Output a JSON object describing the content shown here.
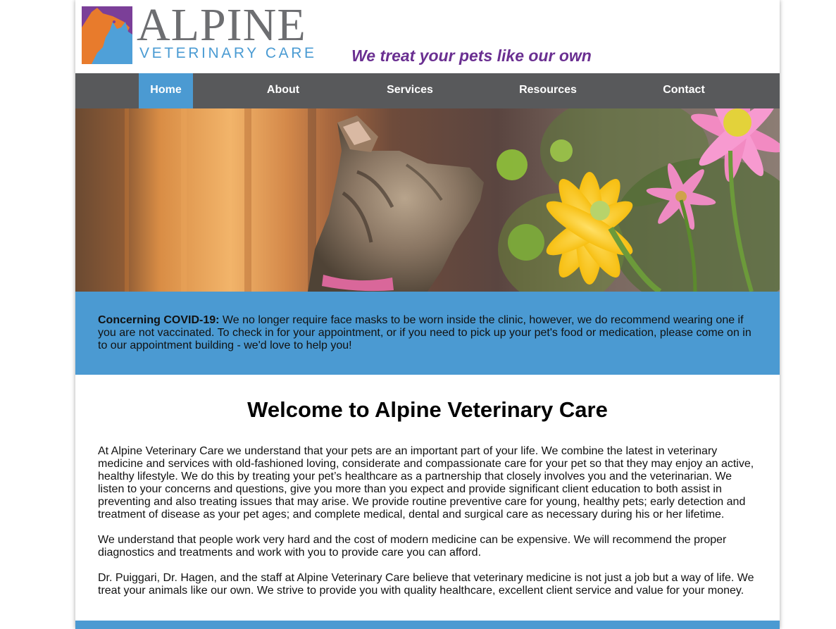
{
  "header": {
    "logo_word": "ALPINE",
    "logo_sub": "VETERINARY CARE",
    "tagline": "We treat your pets like our own"
  },
  "nav": {
    "items": [
      {
        "label": "Home",
        "active": true
      },
      {
        "label": "About",
        "active": false
      },
      {
        "label": "Services",
        "active": false
      },
      {
        "label": "Resources",
        "active": false
      },
      {
        "label": "Contact",
        "active": false
      }
    ]
  },
  "alert": {
    "heading": "Concerning COVID-19:",
    "body": " We no longer require face masks to be worn inside the clinic, however, we do recommend wearing one if you are not vaccinated. To check in for your appointment, or if you need to pick up your pet's food or medication, please come on in to our appointment building - we'd love to help you!"
  },
  "main": {
    "title": "Welcome to Alpine Veterinary Care",
    "paragraphs": [
      "At Alpine Veterinary Care we understand that your pets are an important part of your life. We combine the latest in veterinary medicine and services with old-fashioned loving, considerate and compassionate care for your pet so that they may enjoy an active, healthy lifestyle. We do this by treating your pet’s healthcare as a partnership that closely involves you and the veterinarian. We listen to your concerns and questions, give you more than you expect and provide significant client education to both assist in preventing and also treating issues that may arise. We provide routine preventive care for young, healthy pets; early detection and treatment of disease as your pet ages; and complete medical, dental and surgical care as necessary during his or her lifetime.",
      "We understand that people work very hard and the cost of modern medicine can be expensive. We will recommend the proper diagnostics and treatments and work with you to provide care you can afford.",
      "Dr. Puiggari, Dr. Hagen, and the staff at Alpine Veterinary Care believe that veterinary medicine is not just a job but a way of life. We treat your animals like our own. We strive to provide you with quality healthcare, excellent client service and value for your money."
    ]
  },
  "colors": {
    "nav_bg": "#58595b",
    "accent_blue": "#4b9ad2",
    "tagline_purple": "#6a2f91",
    "logo_gray": "#6d6e71",
    "logo_orange": "#e87b2c",
    "logo_purple": "#7b3f98"
  },
  "icons": {
    "logo_mark": "dog-and-cat-silhouette-icon"
  }
}
